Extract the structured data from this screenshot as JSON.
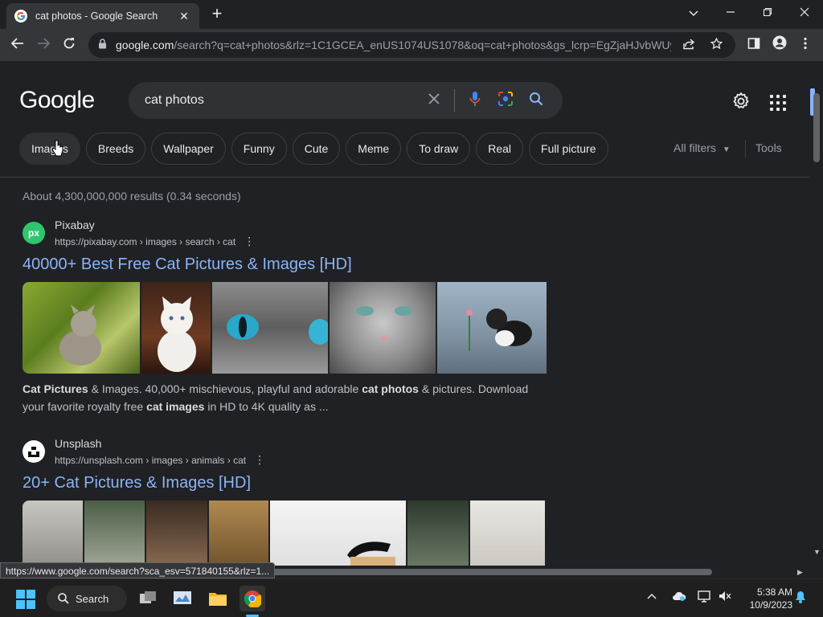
{
  "browser": {
    "tab_title": "cat photos - Google Search",
    "tab_close": "✕",
    "new_tab": "+",
    "url_host": "google.com",
    "url_rest": "/search?q=cat+photos&rlz=1C1GCEA_enUS1074US1078&oq=cat+photos&gs_lcrp=EgZjaHJvbWUy..."
  },
  "search": {
    "logo": "Google",
    "query": "cat photos",
    "chips": [
      "Images",
      "Breeds",
      "Wallpaper",
      "Funny",
      "Cute",
      "Meme",
      "To draw",
      "Real",
      "Full picture"
    ],
    "all_filters": "All filters",
    "tools": "Tools",
    "stats": "About 4,300,000,000 results (0.34 seconds)"
  },
  "results": [
    {
      "site": "Pixabay",
      "favicon_text": "px",
      "url": "https://pixabay.com › images › search › cat",
      "title": "40000+ Best Free Cat Pictures & Images [HD]",
      "snippet_parts": [
        "Cat Pictures",
        " & Images. 40,000+ mischievous, playful and adorable ",
        "cat photos",
        " & pictures. Download your favorite royalty free ",
        "cat images",
        " in HD to 4K quality as ..."
      ]
    },
    {
      "site": "Unsplash",
      "url": "https://unsplash.com › images › animals › cat",
      "title": "20+ Cat Pictures & Images [HD]"
    }
  ],
  "status_url": "https://www.google.com/search?sca_esv=571840155&rlz=1...",
  "taskbar": {
    "search_label": "Search",
    "time": "5:38 AM",
    "date": "10/9/2023"
  },
  "colors": {
    "background": "#202124",
    "link": "#8ab4f8",
    "accent_blue": "#4cc2ff"
  }
}
